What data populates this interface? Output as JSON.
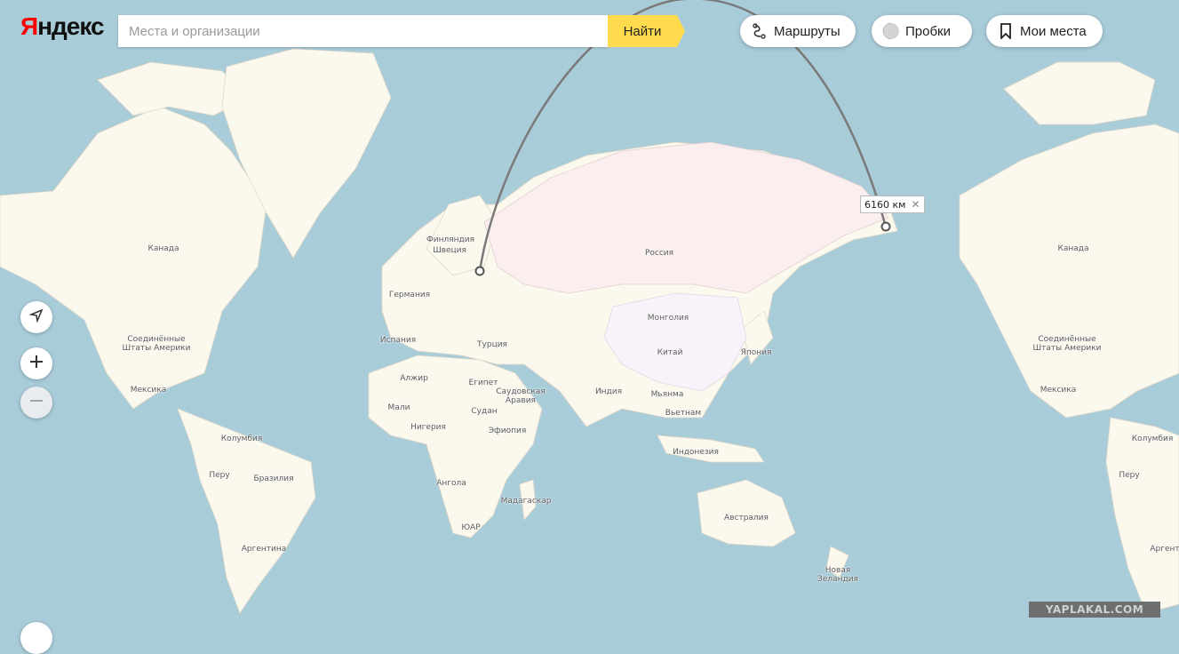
{
  "header": {
    "logo_first": "Я",
    "logo_rest": "ндекс",
    "search_placeholder": "Места и организации",
    "search_button": "Найти"
  },
  "toolbar": {
    "routes": "Маршруты",
    "traffic": "Пробки",
    "my_places": "Мои места"
  },
  "measure": {
    "distance": "6160 км"
  },
  "watermark": "YAPLAKAL.COM",
  "labels": {
    "canada_left": "Канада",
    "canada_right": "Канада",
    "usa_left": "Соединённые\nШтаты Америки",
    "usa_right": "Соединённые\nШтаты Америки",
    "mexico_left": "Мексика",
    "mexico_right": "Мексика",
    "colombia_left": "Колумбия",
    "colombia_right": "Колумбия",
    "peru_left": "Перу",
    "peru_right": "Перу",
    "brazil": "Бразилия",
    "argentina_left": "Аргентина",
    "argentina_right": "Аргент",
    "finland": "Финляндия",
    "sweden": "Швеция",
    "germany": "Германия",
    "spain": "Испания",
    "turkey": "Турция",
    "russia": "Россия",
    "mongolia": "Монголия",
    "china": "Китай",
    "japan": "Япония",
    "algeria": "Алжир",
    "egypt": "Египет",
    "saudi": "Саудовская\nАравия",
    "mali": "Мали",
    "niger": "Нигерия",
    "sudan": "Судан",
    "ethiopia": "Эфиопия",
    "india": "Индия",
    "myanmar": "Мьянма",
    "vietnam": "Вьетнам",
    "indonesia": "Индонезия",
    "angola": "Ангола",
    "madagascar": "Мадагаскар",
    "sar": "ЮАР",
    "australia": "Австралия",
    "nz": "Новая\nЗеландия"
  }
}
